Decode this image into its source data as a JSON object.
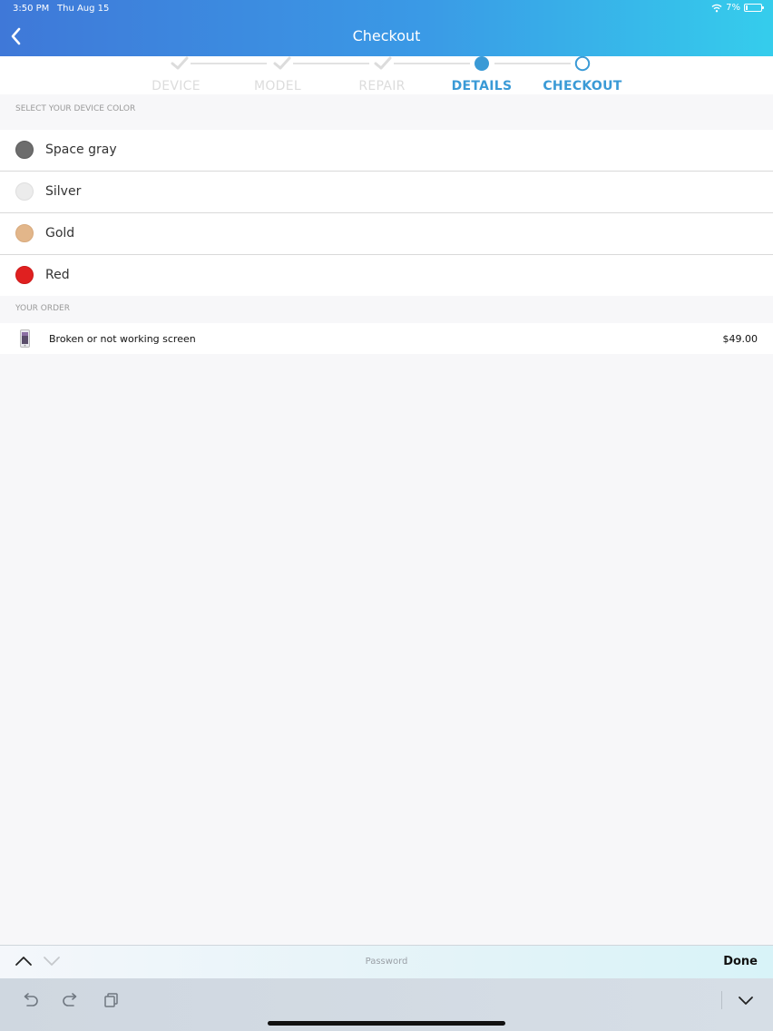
{
  "status_bar": {
    "time": "3:50 PM",
    "date": "Thu Aug 15",
    "battery_percent": "7%",
    "battery_level": 0.07,
    "icons": [
      "wifi-icon",
      "battery-icon"
    ]
  },
  "header": {
    "title": "Checkout",
    "back_icon": "chevron-left-icon",
    "gradient": [
      "#3f78d8",
      "#35cdec"
    ]
  },
  "stepper": {
    "steps": [
      {
        "label": "DEVICE",
        "state": "completed"
      },
      {
        "label": "MODEL",
        "state": "completed"
      },
      {
        "label": "REPAIR",
        "state": "completed"
      },
      {
        "label": "DETAILS",
        "state": "current"
      },
      {
        "label": "CHECKOUT",
        "state": "upcoming"
      }
    ],
    "active_color": "#3a9ad6",
    "completed_color": "#dcdcdc"
  },
  "color_section": {
    "header": "SELECT YOUR DEVICE COLOR",
    "options": [
      {
        "label": "Space gray",
        "color": "#6d6d6d"
      },
      {
        "label": "Silver",
        "color": "#e8e8e8"
      },
      {
        "label": "Gold",
        "color": "#e2b68a"
      },
      {
        "label": "Red",
        "color": "#e02020"
      }
    ]
  },
  "order_section": {
    "header": "YOUR ORDER",
    "items": [
      {
        "label": "Broken or not working screen",
        "price": "$49.00",
        "icon": "phone-thumbnail-icon"
      }
    ]
  },
  "keyboard_accessory": {
    "field_label": "Password",
    "done_label": "Done",
    "icons": [
      "chevron-up-icon",
      "chevron-down-icon"
    ]
  },
  "keyboard_toolbar": {
    "icons": [
      "undo-icon",
      "redo-icon",
      "paste-icon",
      "keyboard-dismiss-icon"
    ]
  }
}
